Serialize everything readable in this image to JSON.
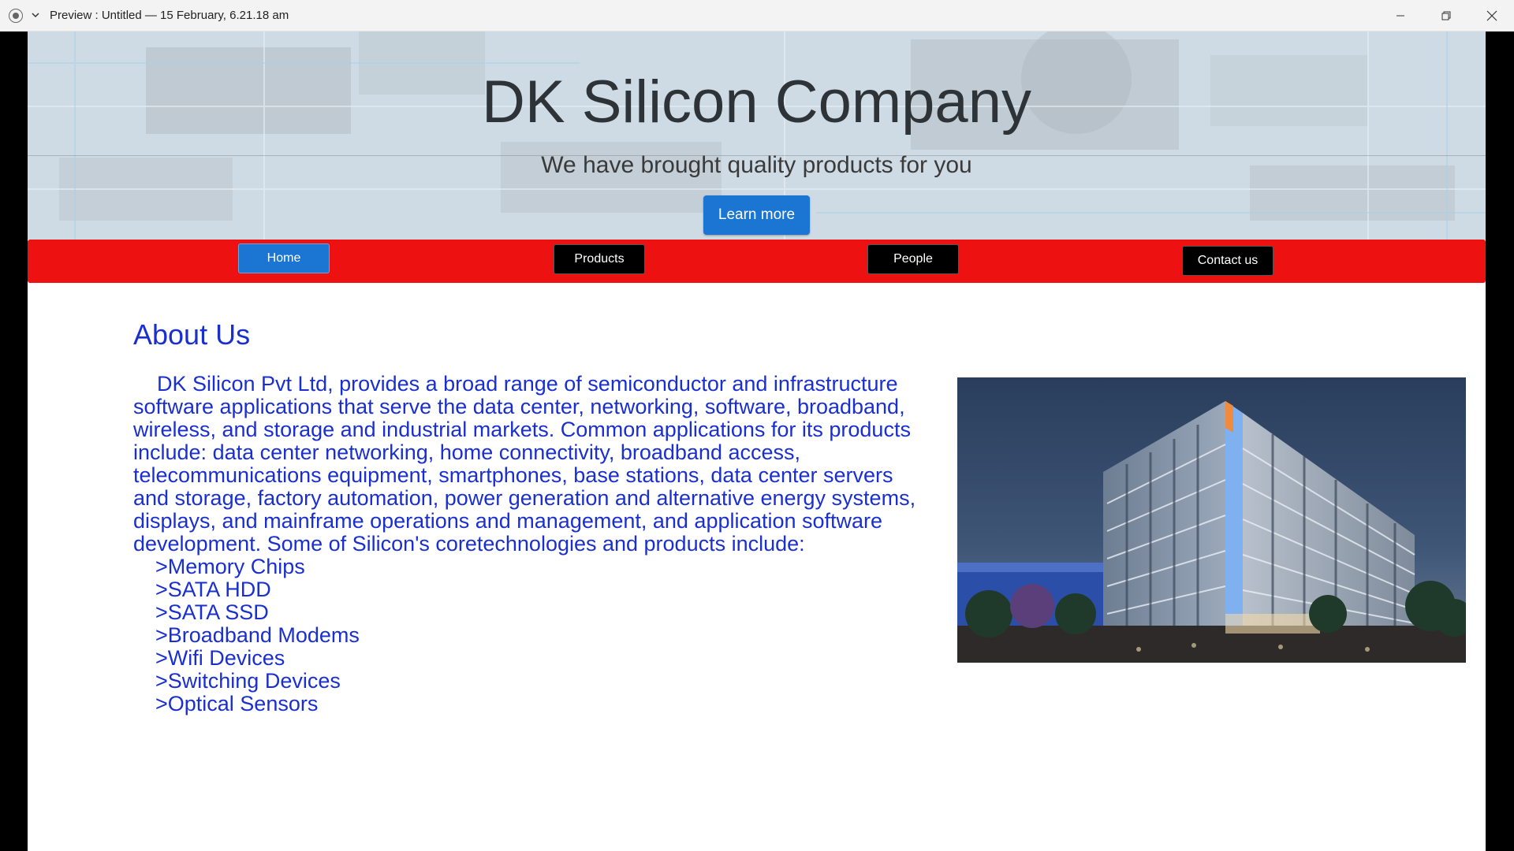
{
  "window": {
    "title": "Preview : Untitled — 15 February, 6.21.18 am",
    "app_icon": "screen-record-icon",
    "controls": [
      "minimize-icon",
      "maximize-icon",
      "close-icon"
    ]
  },
  "hero": {
    "title": "DK Silicon Company",
    "subtitle": "We have brought quality products for you",
    "cta_label": "Learn more"
  },
  "nav": {
    "home": "Home",
    "products": "Products",
    "people": "People",
    "contact": "Contact us"
  },
  "about": {
    "heading": "About Us",
    "paragraph": "DK Silicon Pvt Ltd, provides a broad range of semiconductor and infrastructure software applications that serve the data center, networking, software, broadband, wireless, and storage and industrial markets. Common applications for its products include: data center networking, home connectivity, broadband access, telecommunications equipment, smartphones, base stations, data center servers and storage, factory automation, power generation and alternative energy systems, displays, and mainframe operations and management, and application software development. Some of Silicon's coretechnologies and products include:",
    "products": [
      ">Memory Chips",
      ">SATA HDD",
      ">SATA SSD",
      ">Broadband Modems",
      ">Wifi Devices",
      ">Switching Devices",
      ">Optical Sensors"
    ]
  },
  "colors": {
    "nav_bar": "#ee1111",
    "primary_button": "#1a76d2",
    "about_text": "#1a2fd0"
  }
}
